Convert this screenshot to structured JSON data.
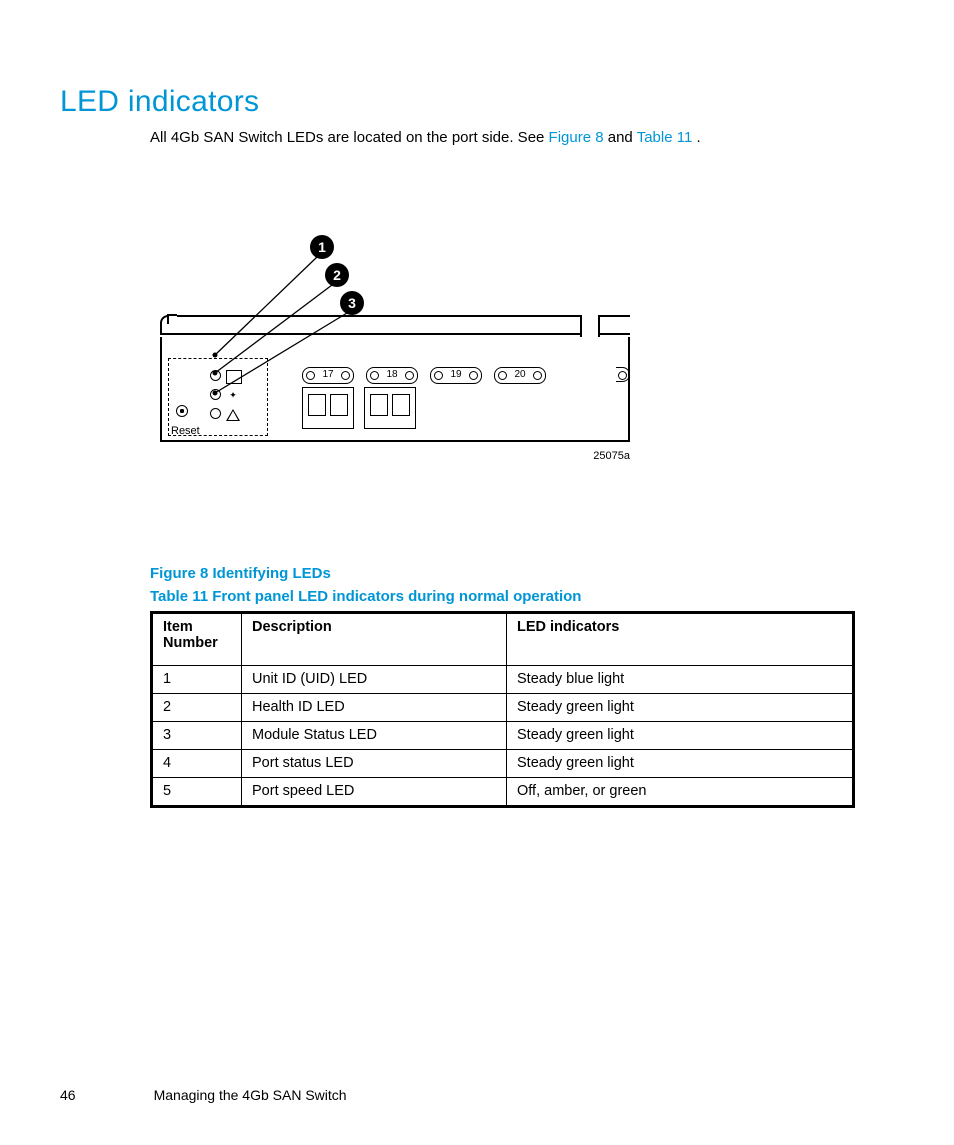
{
  "heading": "LED indicators",
  "intro_pre": "All 4Gb SAN Switch LEDs are located on the port side. See ",
  "intro_link1": "Figure 8",
  "intro_mid": " and ",
  "intro_link2": "Table 11",
  "intro_post": ".",
  "callouts": {
    "c1": "1",
    "c2": "2",
    "c3": "3"
  },
  "ports": {
    "p17": "17",
    "p18": "18",
    "p19": "19",
    "p20": "20"
  },
  "reset_label": "Reset",
  "figure_id": "25075a",
  "figure_caption": "Figure 8 Identifying LEDs",
  "table_caption": "Table 11 Front panel LED indicators during normal operation",
  "table": {
    "headers": {
      "h1": "Item Number",
      "h2": "Description",
      "h3": "LED indicators"
    },
    "rows": [
      {
        "n": "1",
        "d": "Unit ID (UID) LED",
        "i": "Steady blue light"
      },
      {
        "n": "2",
        "d": "Health ID LED",
        "i": "Steady green light"
      },
      {
        "n": "3",
        "d": "Module Status LED",
        "i": "Steady green light"
      },
      {
        "n": "4",
        "d": "Port status LED",
        "i": "Steady green light"
      },
      {
        "n": "5",
        "d": "Port speed LED",
        "i": "Off, amber, or green"
      }
    ]
  },
  "footer": {
    "page": "46",
    "title": "Managing the 4Gb SAN Switch"
  }
}
